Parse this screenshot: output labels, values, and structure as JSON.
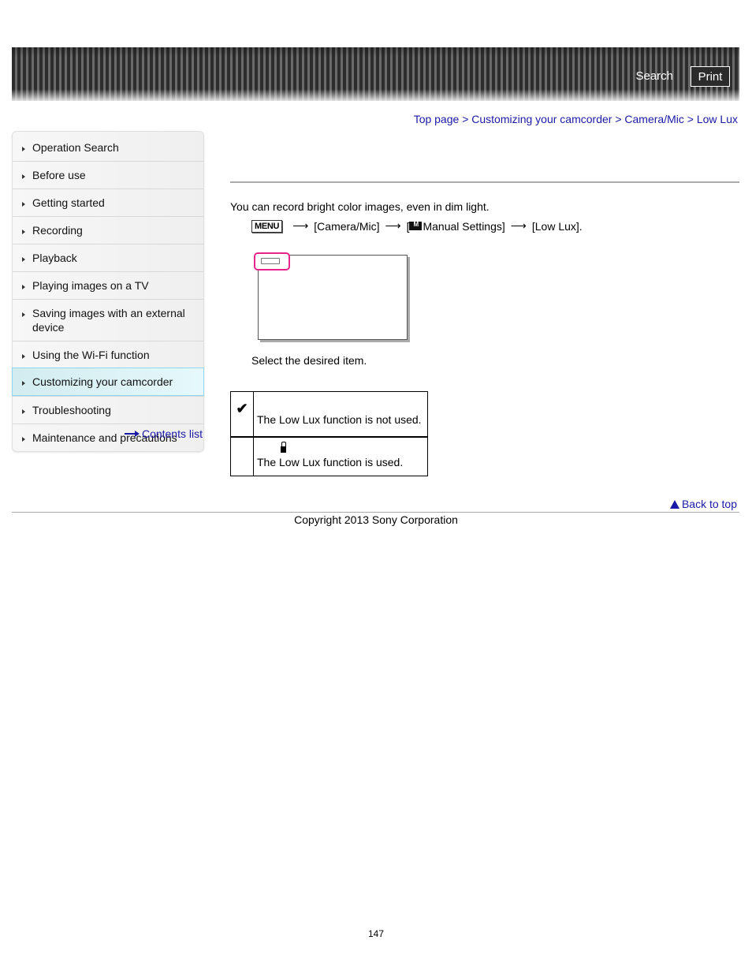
{
  "header": {
    "search_label": "Search",
    "print_label": "Print"
  },
  "breadcrumb": {
    "items": [
      "Top page",
      "Customizing your camcorder",
      "Camera/Mic",
      "Low Lux"
    ],
    "separator": ">"
  },
  "sidebar": {
    "items": [
      {
        "label": "Operation Search"
      },
      {
        "label": "Before use"
      },
      {
        "label": "Getting started"
      },
      {
        "label": "Recording"
      },
      {
        "label": "Playback"
      },
      {
        "label": "Playing images on a TV"
      },
      {
        "label": "Saving images with an external device"
      },
      {
        "label": "Using the Wi-Fi function"
      },
      {
        "label": "Customizing your camcorder",
        "active": true
      },
      {
        "label": "Troubleshooting"
      },
      {
        "label": "Maintenance and precautions"
      }
    ],
    "contents_link": "Contents list"
  },
  "main": {
    "intro": "You can record bright color images, even in dim light.",
    "steps": {
      "menu_button": "MENU",
      "arrow": "⟶",
      "step1": "[Camera/Mic]",
      "step2_open": "[",
      "step2_label": "Manual Settings]",
      "step3": "[Low Lux]."
    },
    "select_text": "Select the desired item.",
    "options": [
      {
        "icon": "check-icon",
        "glyph": "✔",
        "description": "The Low Lux function is not used."
      },
      {
        "icon": "low-lux-icon",
        "glyph": "",
        "description": "The Low Lux function is used."
      }
    ]
  },
  "footer": {
    "back_to_top": "Back to top",
    "copyright": "Copyright 2013 Sony Corporation",
    "page_number": "147"
  }
}
